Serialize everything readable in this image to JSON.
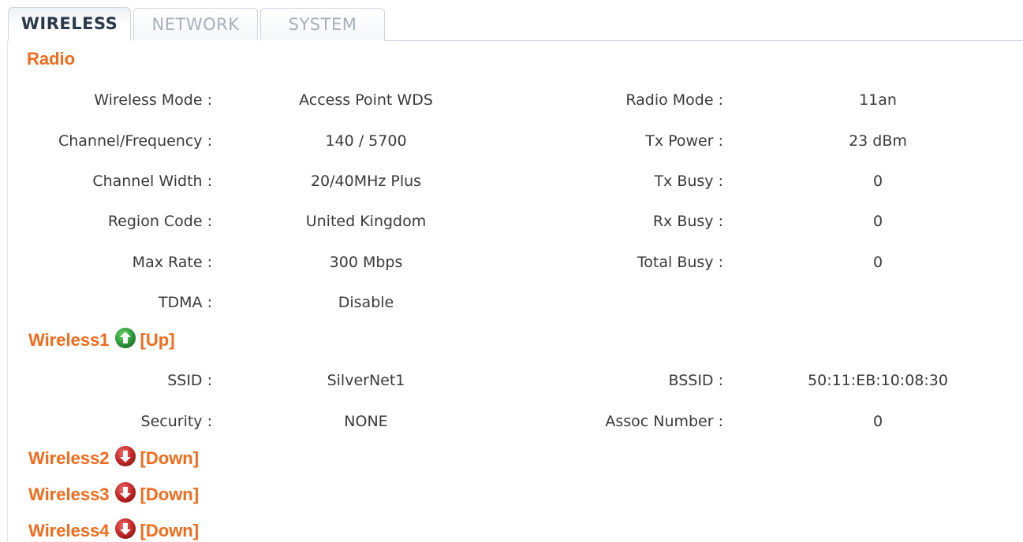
{
  "tabs": [
    {
      "label": "WIRELESS",
      "active": true
    },
    {
      "label": "NETWORK",
      "active": false
    },
    {
      "label": "SYSTEM",
      "active": false
    }
  ],
  "radio": {
    "title": "Radio",
    "rows": [
      {
        "label1": "Wireless Mode :",
        "value1": "Access Point WDS",
        "label2": "Radio Mode :",
        "value2": "11an"
      },
      {
        "label1": "Channel/Frequency :",
        "value1": "140 / 5700",
        "label2": "Tx Power :",
        "value2": "23 dBm"
      },
      {
        "label1": "Channel Width :",
        "value1": "20/40MHz Plus",
        "label2": "Tx Busy :",
        "value2": "0"
      },
      {
        "label1": "Region Code :",
        "value1": "United Kingdom",
        "label2": "Rx Busy :",
        "value2": "0"
      },
      {
        "label1": "Max Rate :",
        "value1": "300 Mbps",
        "label2": "Total Busy :",
        "value2": "0"
      },
      {
        "label1": "TDMA :",
        "value1": "Disable",
        "label2": "",
        "value2": ""
      }
    ]
  },
  "wireless1": {
    "name": "Wireless1",
    "state": "[Up]",
    "icon": "arrow-up-circle-icon",
    "icon_color": "#2e9e3a",
    "rows": [
      {
        "label1": "SSID :",
        "value1": "SilverNet1",
        "label2": "BSSID :",
        "value2": "50:11:EB:10:08:30"
      },
      {
        "label1": "Security :",
        "value1": "NONE",
        "label2": "Assoc Number :",
        "value2": "0"
      }
    ]
  },
  "wireless2": {
    "name": "Wireless2",
    "state": "[Down]",
    "icon": "arrow-down-circle-icon",
    "icon_color": "#c62828"
  },
  "wireless3": {
    "name": "Wireless3",
    "state": "[Down]",
    "icon": "arrow-down-circle-icon",
    "icon_color": "#c62828"
  },
  "wireless4": {
    "name": "Wireless4",
    "state": "[Down]",
    "icon": "arrow-down-circle-icon",
    "icon_color": "#c62828"
  },
  "colors": {
    "section_title": "#f26a1b",
    "up": "#2e9e3a",
    "down": "#c62828"
  }
}
